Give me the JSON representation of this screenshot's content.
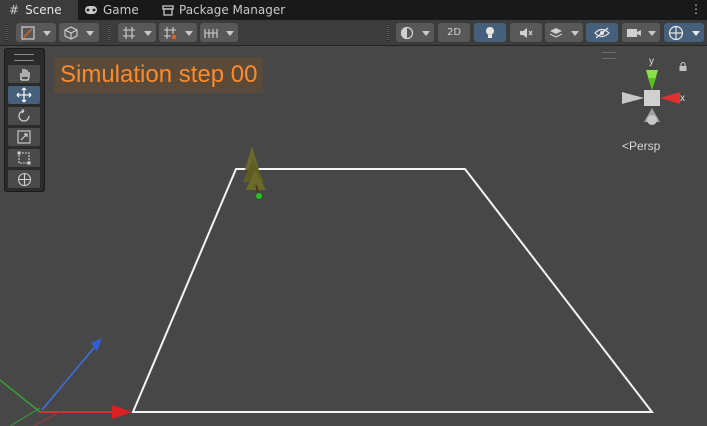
{
  "tabs": [
    {
      "label": "Scene",
      "icon": "hash-icon",
      "active": true
    },
    {
      "label": "Game",
      "icon": "gamepad-icon",
      "active": false
    },
    {
      "label": "Package Manager",
      "icon": "package-icon",
      "active": false
    }
  ],
  "toolbar": {
    "mode_2d_label": "2D",
    "accent": "#46607c"
  },
  "overlay": {
    "simulation_label": "Simulation step 00",
    "label_color": "#ff8a2a"
  },
  "gizmo": {
    "x_label": "x",
    "y_label": "y",
    "projection_label": "<Persp"
  }
}
